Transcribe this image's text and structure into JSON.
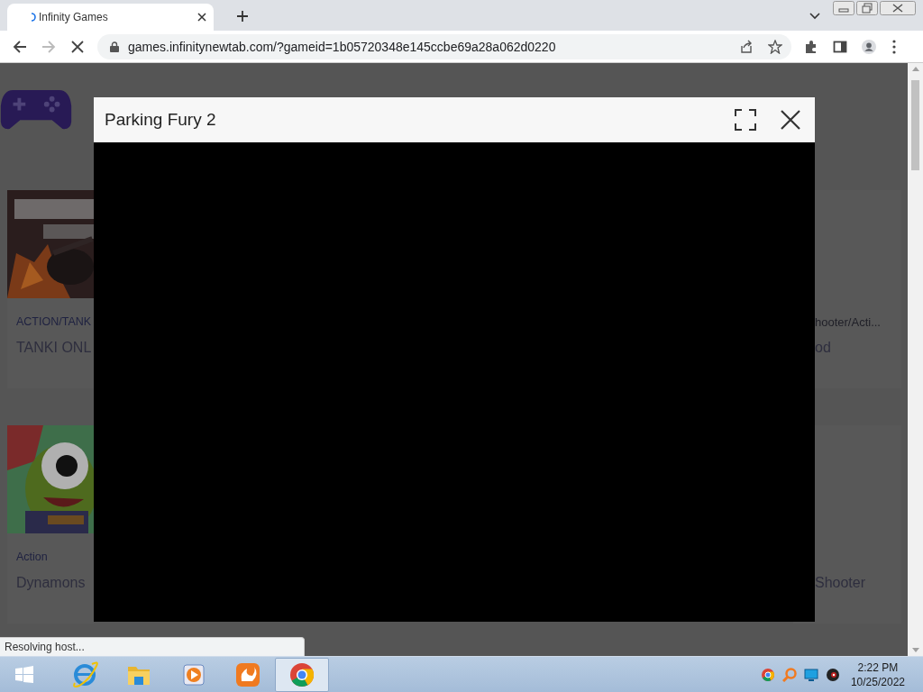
{
  "browser": {
    "tab": {
      "title": "Infinity Games",
      "loading": true
    },
    "url": "games.infinitynewtab.com/?gameid=1b05720348e145ccbe69a28a062d0220",
    "loading": true
  },
  "page": {
    "left_cards": [
      {
        "category": "ACTION/TANK",
        "title": "TANKI ONL"
      },
      {
        "category": "Action",
        "title": "Dynamons"
      }
    ],
    "right_cards": [
      {
        "category": "hooter/Acti...",
        "title": "od"
      },
      {
        "title": "Shooter"
      }
    ]
  },
  "modal": {
    "title": "Parking Fury 2"
  },
  "status_text": "Resolving host...",
  "taskbar": {
    "apps": [
      {
        "kind": "ie",
        "selected": false
      },
      {
        "kind": "folder",
        "selected": false
      },
      {
        "kind": "media",
        "selected": false
      },
      {
        "kind": "uc",
        "selected": false
      },
      {
        "kind": "chrome",
        "selected": true
      }
    ],
    "tray": [
      {
        "kind": "chrome"
      },
      {
        "kind": "search"
      },
      {
        "kind": "monitor"
      },
      {
        "kind": "camera"
      }
    ],
    "time": "2:22 PM",
    "date": "10/25/2022"
  }
}
